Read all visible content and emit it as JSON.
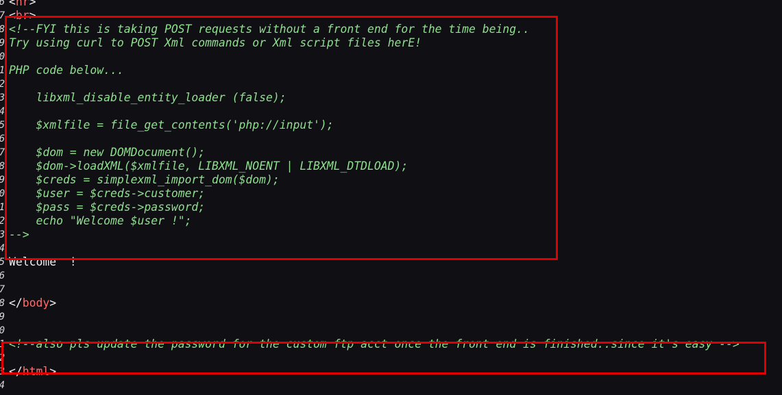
{
  "gutter": {
    "line_digits": [
      "6",
      "7",
      "8",
      "9",
      "0",
      "1",
      "2",
      "3",
      "4",
      "5",
      "6",
      "7",
      "8",
      "9",
      "0",
      "1",
      "2",
      "3",
      "4",
      "5",
      "6",
      "7",
      "8",
      "9",
      "0",
      "1",
      "2",
      "3",
      "4"
    ]
  },
  "source": {
    "hr_open": "<",
    "hr_tag": "hr",
    "hr_close": ">",
    "br_open": "<",
    "br_tag": "br",
    "br_close": ">",
    "comment_lines": [
      "<!--FYI this is taking POST requests without a front end for the time being..",
      "Try using curl to POST Xml commands or Xml script files herE!",
      "",
      "PHP code below...",
      "",
      "    libxml_disable_entity_loader (false);",
      "",
      "    $xmlfile = file_get_contents('php://input');",
      "",
      "    $dom = new DOMDocument();",
      "    $dom->loadXML($xmlfile, LIBXML_NOENT | LIBXML_DTDLOAD);",
      "    $creds = simplexml_import_dom($dom);",
      "    $user = $creds->customer;",
      "    $pass = $creds->password;",
      "    echo \"Welcome $user !\";",
      "-->"
    ],
    "welcome_text": "Welcome  !",
    "body_close_open": "</",
    "body_close_tag": "body",
    "body_close_end": ">",
    "second_comment": "<!--also pls update the password for the custom ftp acct once the front end is finished..since it's easy -->",
    "html_close_open": "</",
    "html_close_tag": "html",
    "html_close_end": ">"
  },
  "colors": {
    "background": "#101014",
    "comment": "#8ee08e",
    "tag": "#ff6b6b",
    "plain": "#f0f0f0",
    "highlight_box": "#e00000"
  }
}
